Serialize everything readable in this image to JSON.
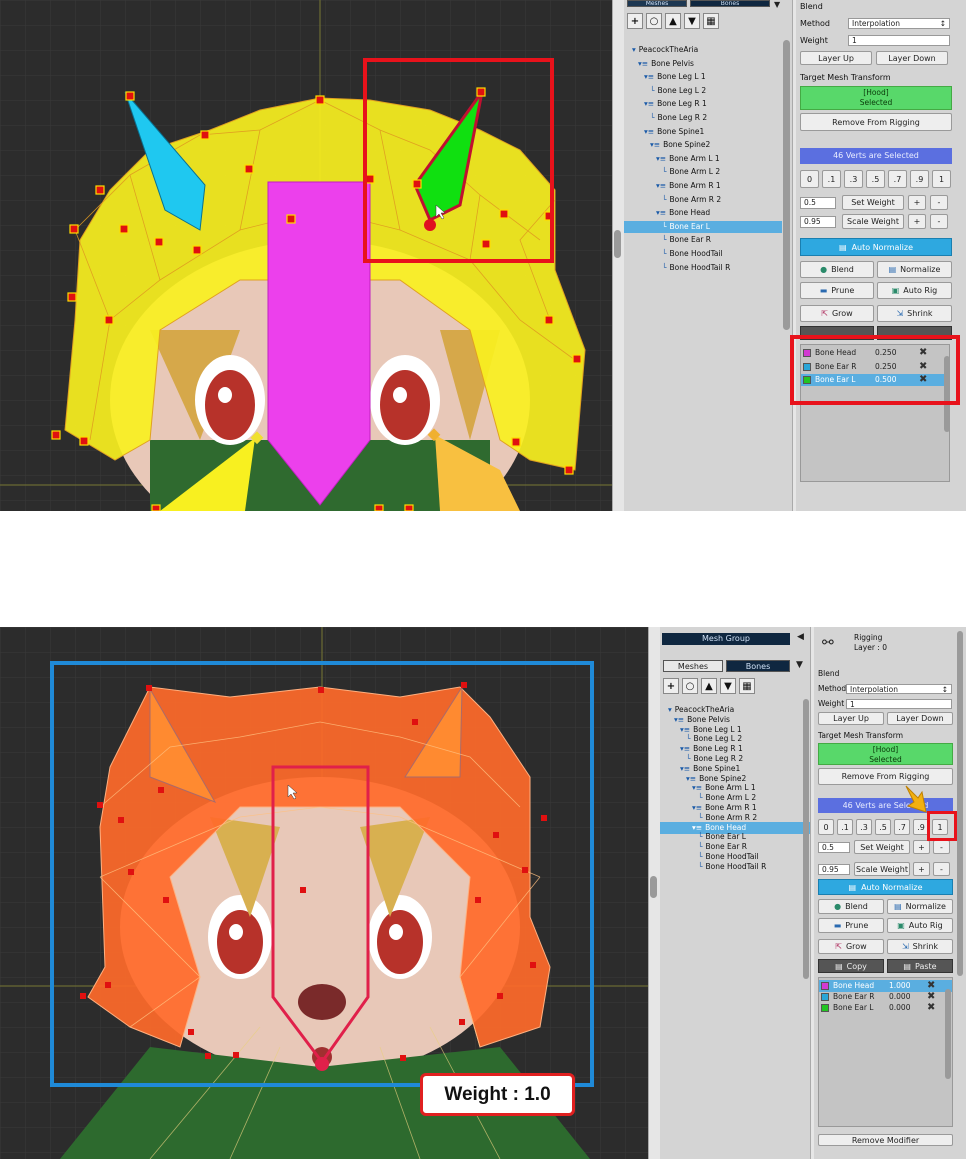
{
  "top_screen": {
    "tabs": [
      "Meshes",
      "Bones"
    ],
    "tree": [
      "PeacockTheAria",
      "Bone Pelvis",
      "Bone Leg L 1",
      "Bone Leg L 2",
      "Bone Leg R 1",
      "Bone Leg R 2",
      "Bone Spine1",
      "Bone Spine2",
      "Bone Arm L 1",
      "Bone Arm L 2",
      "Bone Arm R 1",
      "Bone Arm R 2",
      "Bone Head",
      "Bone Ear L",
      "Bone Ear R",
      "Bone HoodTail",
      "Bone HoodTail R"
    ],
    "selected_tree_item": "Bone Ear L",
    "blend_label": "Blend",
    "method_label": "Method",
    "method_value": "Interpolation",
    "weight_label": "Weight",
    "weight_value": "1",
    "layer_up": "Layer Up",
    "layer_down": "Layer Down",
    "target_mesh_label": "Target Mesh Transform",
    "target_mesh_name": "[Hood]",
    "target_mesh_state": "Selected",
    "remove_from_rigging": "Remove From Rigging",
    "verts_selected": "46 Verts are Selected",
    "weight_presets": [
      "0",
      ".1",
      ".3",
      ".5",
      ".7",
      ".9",
      "1"
    ],
    "set_weight_value": "0.5",
    "set_weight_label": "Set Weight",
    "scale_weight_value": "0.95",
    "scale_weight_label": "Scale Weight",
    "plus": "+",
    "minus": "-",
    "auto_normalize": "Auto Normalize",
    "blend_btn": "Blend",
    "normalize_btn": "Normalize",
    "prune_btn": "Prune",
    "auto_rig_btn": "Auto Rig",
    "grow_btn": "Grow",
    "shrink_btn": "Shrink",
    "weights": [
      {
        "name": "Bone Head",
        "value": "0.250",
        "color": "#d23ad2"
      },
      {
        "name": "Bone Ear R",
        "value": "0.250",
        "color": "#2aa6d8"
      },
      {
        "name": "Bone Ear L",
        "value": "0.500",
        "color": "#22c422"
      }
    ]
  },
  "bottom_screen": {
    "mesh_group_label": "Mesh Group",
    "tabs": [
      "Meshes",
      "Bones"
    ],
    "rigging_title": "Rigging",
    "rigging_layer": "Layer : 0",
    "tree": [
      "PeacockTheAria",
      "Bone Pelvis",
      "Bone Leg L 1",
      "Bone Leg L 2",
      "Bone Leg R 1",
      "Bone Leg R 2",
      "Bone Spine1",
      "Bone Spine2",
      "Bone Arm L 1",
      "Bone Arm L 2",
      "Bone Arm R 1",
      "Bone Arm R 2",
      "Bone Head",
      "Bone Ear L",
      "Bone Ear R",
      "Bone HoodTail",
      "Bone HoodTail R"
    ],
    "selected_tree_item": "Bone Head",
    "blend_label": "Blend",
    "method_label": "Method",
    "method_value": "Interpolation",
    "weight_label": "Weight",
    "weight_value": "1",
    "layer_up": "Layer Up",
    "layer_down": "Layer Down",
    "target_mesh_label": "Target Mesh Transform",
    "target_mesh_name": "[Hood]",
    "target_mesh_state": "Selected",
    "remove_from_rigging": "Remove From Rigging",
    "verts_selected": "46 Verts are Selected",
    "weight_presets": [
      "0",
      ".1",
      ".3",
      ".5",
      ".7",
      ".9",
      "1"
    ],
    "set_weight_value": "0.5",
    "set_weight_label": "Set Weight",
    "scale_weight_value": "0.95",
    "scale_weight_label": "Scale Weight",
    "plus": "+",
    "minus": "-",
    "auto_normalize": "Auto Normalize",
    "blend_btn": "Blend",
    "normalize_btn": "Normalize",
    "prune_btn": "Prune",
    "auto_rig_btn": "Auto Rig",
    "grow_btn": "Grow",
    "shrink_btn": "Shrink",
    "copy_btn": "Copy",
    "paste_btn": "Paste",
    "weights": [
      {
        "name": "Bone Head",
        "value": "1.000",
        "color": "#d23ad2"
      },
      {
        "name": "Bone Ear R",
        "value": "0.000",
        "color": "#2aa6d8"
      },
      {
        "name": "Bone Ear L",
        "value": "0.000",
        "color": "#22c422"
      }
    ],
    "remove_modifier": "Remove Modifier",
    "callout": "Weight : 1.0"
  },
  "colors": {
    "highlight_red": "#e8121b",
    "selection_blue": "#5aaee0",
    "verts_bar": "#5b6fe0",
    "auto_normalize": "#2ea8e0",
    "target_mesh_green": "#58d86a"
  }
}
